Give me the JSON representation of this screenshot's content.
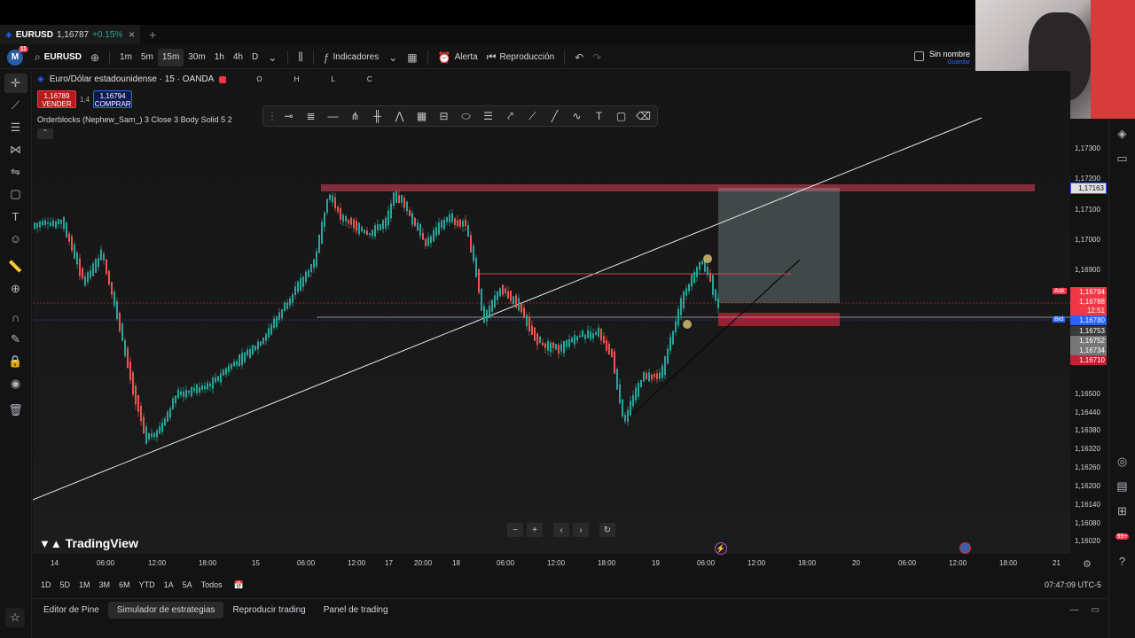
{
  "browser_tab": {
    "symbol": "EURUSD",
    "price": "1,16787",
    "change": "+0.15%",
    "close": "×",
    "new": "+"
  },
  "toolbar": {
    "avatar_letter": "M",
    "avatar_badge": "11",
    "symbol": "EURUSD",
    "intervals": [
      "1m",
      "5m",
      "15m",
      "30m",
      "1h",
      "4h",
      "D"
    ],
    "active_interval": "15m",
    "indicators": "Indicadores",
    "alert": "Alerta",
    "replay": "Reproducción",
    "layout_name": "Sin nombre",
    "save_hint": "Guardar"
  },
  "legend": {
    "title": "Euro/Dólar estadounidense · 15 · OANDA",
    "o_label": "O",
    "h_label": "H",
    "l_label": "L",
    "c_label": "C",
    "sell_price": "1,16789",
    "sell_label": "VENDER",
    "spread": "1,4",
    "buy_price": "1,16794",
    "buy_label": "COMPRAR",
    "indicator": "Orderblocks (Nephew_Sam_) 3 Close 3 Body Solid 5 2"
  },
  "price_scale": {
    "ticks": [
      "1,17300",
      "1,17200",
      "1,17100",
      "1,17000",
      "1,16900",
      "1,16500",
      "1,16440",
      "1,16380",
      "1,16320",
      "1,16260",
      "1,16200",
      "1,16140",
      "1,16080",
      "1,16020"
    ],
    "labels": {
      "top_line": "1,17163",
      "ask_tag": "Ask",
      "ask": "1,16794",
      "last": "1,16788",
      "countdown": "12:51",
      "bid_tag": "Bid",
      "bid": "1,16780",
      "l1": "1,16753",
      "l2": "1,16752",
      "l3": "1,16734",
      "l4": "1,16710"
    }
  },
  "time_scale": [
    "14",
    "06:00",
    "12:00",
    "18:00",
    "15",
    "06:00",
    "12:00",
    "17",
    "20:00",
    "18",
    "06:00",
    "12:00",
    "18:00",
    "19",
    "06:00",
    "12:00",
    "18:00",
    "20",
    "06:00",
    "12:00",
    "18:00",
    "21"
  ],
  "ranges": [
    "1D",
    "5D",
    "1M",
    "3M",
    "6M",
    "YTD",
    "1A",
    "5A",
    "Todos"
  ],
  "clock": "07:47:09 UTC-5",
  "brand": "TradingView",
  "bottom_tabs": [
    "Editor de Pine",
    "Simulador de estrategias",
    "Reproducir trading",
    "Panel de trading"
  ],
  "active_bottom_tab": "Simulador de estrategias",
  "right_badge": "99+",
  "colors": {
    "up": "#26a69a",
    "down": "#ef5350",
    "ask": "#f23645",
    "bid": "#2962ff"
  }
}
